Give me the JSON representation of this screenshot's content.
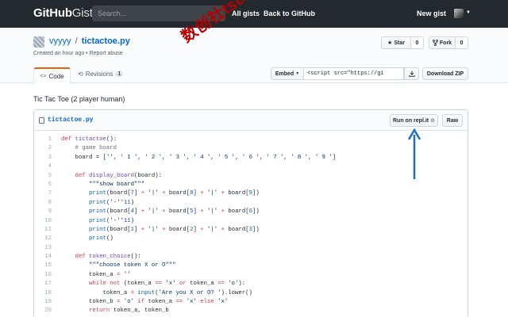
{
  "header": {
    "logo_primary": "GitHub",
    "logo_secondary": "Gist",
    "search_placeholder": "Search...",
    "nav": [
      "All gists",
      "Back to GitHub"
    ],
    "new_gist": "New gist"
  },
  "gist": {
    "owner": "vyyyy",
    "separator": "/",
    "filename": "tictactoe.py",
    "created": "Created an hour ago",
    "bullet": "•",
    "report": "Report abuse",
    "star_label": "Star",
    "star_count": "0",
    "fork_label": "Fork",
    "fork_count": "0",
    "tabs": {
      "code": "Code",
      "revisions": "Revisions",
      "revisions_count": "1"
    },
    "embed_label": "Embed",
    "embed_value": "<script src=\"https://gi",
    "download_label": "Download ZIP"
  },
  "description": "Tic Tac Toe (2 player human)",
  "file": {
    "name": "tictactoe.py",
    "run_label": "Run on repl.it",
    "raw_label": "Raw",
    "lines": [
      {
        "n": "1",
        "html": "<span class='kw'>def</span> <span class='fn'>tictactoe</span>():"
      },
      {
        "n": "2",
        "html": "    <span class='cm'># game board</span>"
      },
      {
        "n": "3",
        "html": "    board = [<span class='str'>''</span>, <span class='str'>' 1 '</span>, <span class='str'>' 2 '</span>, <span class='str'>' 3 '</span>, <span class='str'>' 4 '</span>, <span class='str'>' 5 '</span>, <span class='str'>' 6 '</span>, <span class='str'>' 7 '</span>, <span class='str'>' 8 '</span>, <span class='str'>' 9 '</span>]"
      },
      {
        "n": "4",
        "html": ""
      },
      {
        "n": "5",
        "html": "    <span class='kw'>def</span> <span class='fn'>display_board</span>(board):"
      },
      {
        "n": "6",
        "html": "        <span class='str'>\"\"\"show board\"\"\"</span>"
      },
      {
        "n": "7",
        "html": "        <span class='bi'>print</span>(board[<span class='bi'>7</span>] <span class='kw'>+</span> <span class='str'>'|'</span> <span class='kw'>+</span> board[<span class='bi'>8</span>] <span class='kw'>+</span> <span class='str'>'|'</span> <span class='kw'>+</span> board[<span class='bi'>9</span>])"
      },
      {
        "n": "8",
        "html": "        <span class='bi'>print</span>(<span class='str'>'-'</span><span class='kw'>*</span><span class='bi'>11</span>)"
      },
      {
        "n": "9",
        "html": "        <span class='bi'>print</span>(board[<span class='bi'>4</span>] <span class='kw'>+</span> <span class='str'>'|'</span> <span class='kw'>+</span> board[<span class='bi'>5</span>] <span class='kw'>+</span> <span class='str'>'|'</span> <span class='kw'>+</span> board[<span class='bi'>6</span>])"
      },
      {
        "n": "10",
        "html": "        <span class='bi'>print</span>(<span class='str'>'-'</span><span class='kw'>*</span><span class='bi'>11</span>)"
      },
      {
        "n": "11",
        "html": "        <span class='bi'>print</span>(board[<span class='bi'>1</span>] <span class='kw'>+</span> <span class='str'>'|'</span> <span class='kw'>+</span> board[<span class='bi'>2</span>] <span class='kw'>+</span> <span class='str'>'|'</span> <span class='kw'>+</span> board[<span class='bi'>3</span>])"
      },
      {
        "n": "12",
        "html": "        <span class='bi'>print</span>()"
      },
      {
        "n": "13",
        "html": ""
      },
      {
        "n": "14",
        "html": "    <span class='kw'>def</span> <span class='fn'>token_choice</span>():"
      },
      {
        "n": "15",
        "html": "        <span class='str'>\"\"\"choose token X or O\"\"\"</span>"
      },
      {
        "n": "16",
        "html": "        token_a <span class='kw'>=</span> <span class='str'>''</span>"
      },
      {
        "n": "17",
        "html": "        <span class='kw'>while not</span> (token_a <span class='kw'>==</span> <span class='str'>'x'</span> <span class='kw'>or</span> token_a <span class='kw'>==</span> <span class='str'>'o'</span>):"
      },
      {
        "n": "18",
        "html": "            token_a <span class='kw'>=</span> <span class='bi'>input</span>(<span class='str'>'Are you X or O? '</span>).lower()"
      },
      {
        "n": "19",
        "html": "        token_b <span class='kw'>=</span> <span class='str'>'o'</span> <span class='kw'>if</span> token_a <span class='kw'>==</span> <span class='str'>'x'</span> <span class='kw'>else</span> <span class='str'>'x'</span>"
      },
      {
        "n": "20",
        "html": "        <span class='kw'>return</span> token_a, token_b"
      },
      {
        "n": "21",
        "html": ""
      }
    ]
  },
  "annotations": {
    "watermark": "数创社tscs60",
    "arrow_color": "#1f6fbf"
  },
  "icons": [
    "code-icon",
    "history-icon",
    "star-icon",
    "fork-icon",
    "clipboard-icon",
    "download-icon",
    "file-icon",
    "replit-icon",
    "caret-icon"
  ],
  "colors": {
    "header_bg": "#24292e",
    "link": "#0366d6",
    "tab_accent": "#e36209",
    "watermark": "#b80000"
  }
}
